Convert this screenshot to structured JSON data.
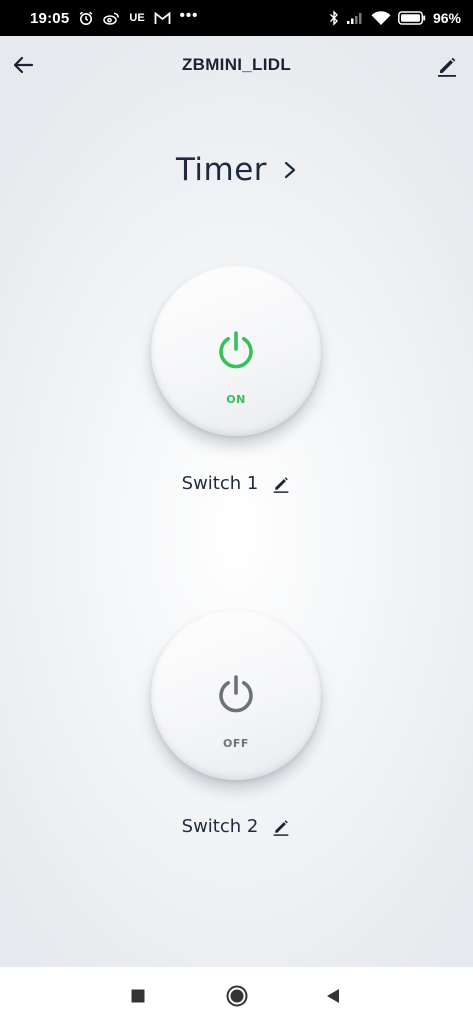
{
  "status_bar": {
    "time": "19:05",
    "carrier": "UE",
    "more": "•••",
    "battery_percent": "96%"
  },
  "header": {
    "title": "ZBMINI_LIDL"
  },
  "timer": {
    "label": "Timer"
  },
  "switches": [
    {
      "name": "Switch 1",
      "state": "ON",
      "color": "#34c25a"
    },
    {
      "name": "Switch 2",
      "state": "OFF",
      "color": "#6e7278"
    }
  ],
  "icons": {
    "back": "arrow-left-icon",
    "edit": "pencil-icon",
    "chevron": "chevron-right-icon",
    "power": "power-icon",
    "nav_recents": "square-icon",
    "nav_home": "circle-icon",
    "nav_back": "triangle-back-icon"
  }
}
